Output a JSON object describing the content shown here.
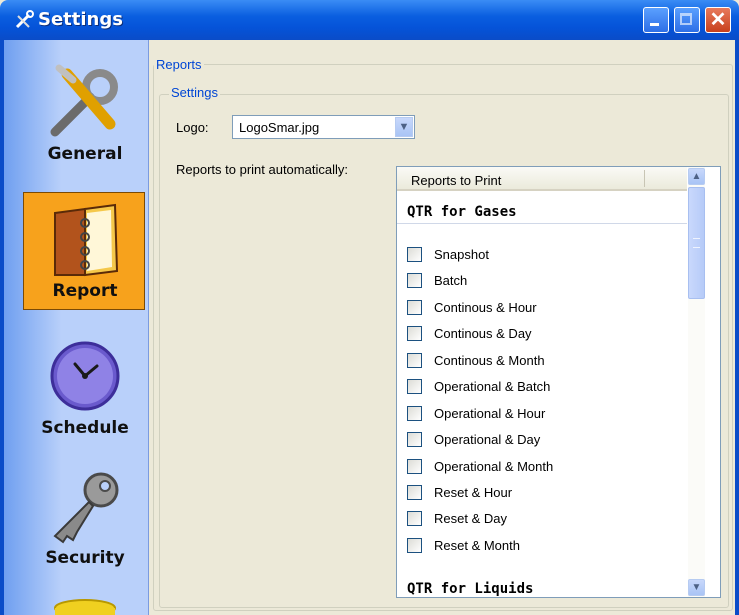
{
  "window": {
    "title": "Settings"
  },
  "sidebar": {
    "items": [
      {
        "label": "General",
        "icon": "tools-icon"
      },
      {
        "label": "Report",
        "icon": "notebook-icon",
        "active": true
      },
      {
        "label": "Schedule",
        "icon": "clock-icon"
      },
      {
        "label": "Security",
        "icon": "key-icon"
      },
      {
        "label": "",
        "icon": "database-icon"
      }
    ]
  },
  "reports_group": {
    "label": "Reports",
    "settings_group": {
      "label": "Settings",
      "logo_label": "Logo:",
      "logo_value": "LogoSmar.jpg",
      "auto_print_label": "Reports to print automatically:",
      "list": {
        "column_header": "Reports to Print",
        "section_gases": "QTR for Gases",
        "section_liquids": "QTR for Liquids",
        "items": [
          "Snapshot",
          "Batch",
          "Continous & Hour",
          "Continous & Day",
          "Continous & Month",
          "Operational & Batch",
          "Operational & Hour",
          "Operational & Day",
          "Operational & Month",
          "Reset & Hour",
          "Reset & Day",
          "Reset & Month"
        ]
      }
    }
  },
  "colors": {
    "titlebar": "#0553d8",
    "sidebar": "#b9d0fa",
    "active_item": "#f7a21c",
    "group_label": "#0046d5"
  }
}
